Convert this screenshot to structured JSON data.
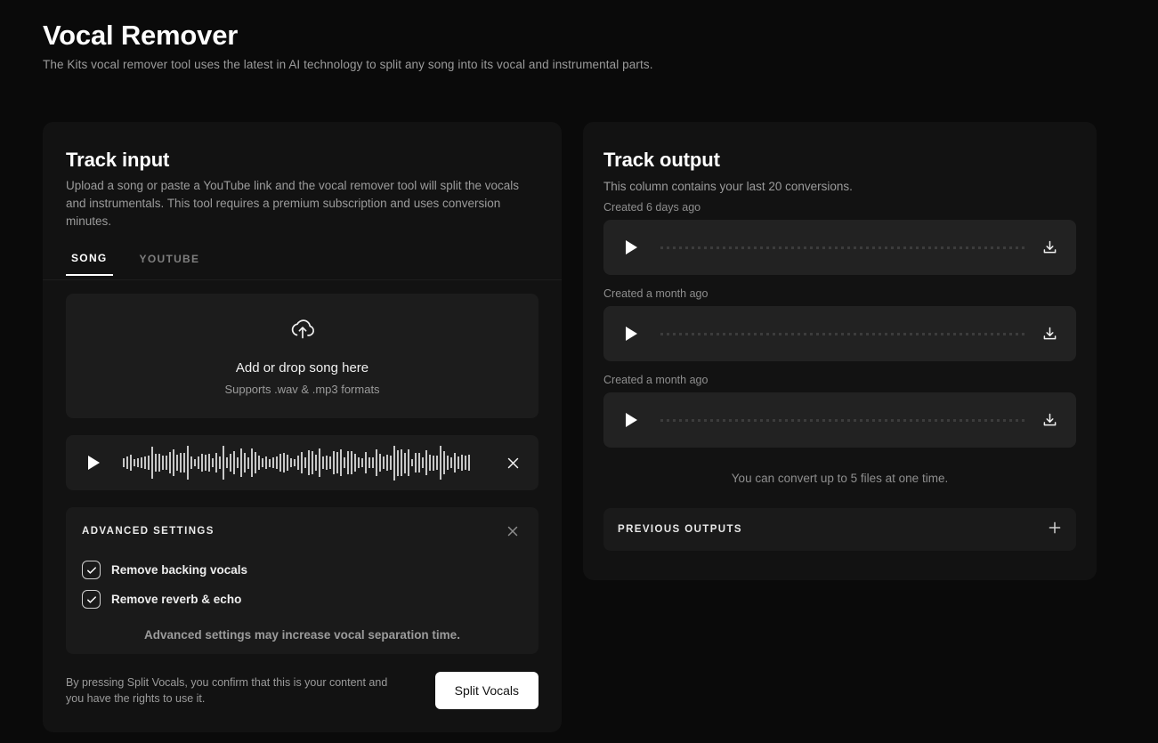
{
  "header": {
    "title": "Vocal Remover",
    "subtitle": "The Kits vocal remover tool uses the latest in AI technology to split any song into its vocal and instrumental parts."
  },
  "track_input": {
    "title": "Track input",
    "description": "Upload a song or paste a YouTube link and the vocal remover tool will split the vocals and instrumentals. This tool requires a premium subscription and uses conversion minutes.",
    "tabs": [
      {
        "label": "SONG",
        "active": true
      },
      {
        "label": "YOUTUBE",
        "active": false
      }
    ],
    "dropzone": {
      "icon": "cloud-upload-icon",
      "title": "Add or drop song here",
      "subtitle": "Supports .wav & .mp3 formats"
    },
    "loaded_track": {
      "play_icon": "play-icon",
      "remove_icon": "close-icon"
    },
    "advanced_settings": {
      "title": "ADVANCED SETTINGS",
      "close_icon": "close-icon",
      "options": [
        {
          "label": "Remove backing vocals",
          "checked": true
        },
        {
          "label": "Remove reverb & echo",
          "checked": true
        }
      ],
      "note": "Advanced settings may increase vocal separation time."
    },
    "footer": {
      "disclaimer": "By pressing Split Vocals, you confirm that this is your content and you have the rights to use it.",
      "submit_label": "Split Vocals"
    }
  },
  "track_output": {
    "title": "Track output",
    "description": "This column contains your last 20 conversions.",
    "items": [
      {
        "created": "Created 6 days ago",
        "play_icon": "play-icon",
        "download_icon": "download-icon"
      },
      {
        "created": "Created a month ago",
        "play_icon": "play-icon",
        "download_icon": "download-icon"
      },
      {
        "created": "Created a month ago",
        "play_icon": "play-icon",
        "download_icon": "download-icon"
      }
    ],
    "limit_note": "You can convert up to 5 files at one time.",
    "previous_outputs": {
      "label": "PREVIOUS OUTPUTS",
      "expand_icon": "plus-icon"
    }
  },
  "colors": {
    "page_bg": "#0a0a0a",
    "card_bg": "#121212",
    "panel_bg": "#1c1c1c",
    "accent": "#ffffff",
    "muted_text": "#9b9b9b"
  }
}
